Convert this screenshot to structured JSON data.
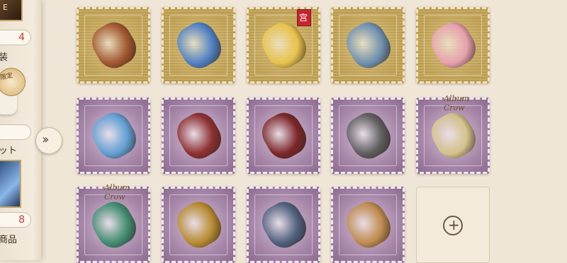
{
  "sidebar": {
    "corner_label": "E",
    "count_top": "4",
    "text_1": "装",
    "limited_badge": "限定",
    "text_2": "ット",
    "count_bottom": "8",
    "text_3": "商品",
    "expand_icon": "double-chevron-right-icon"
  },
  "slots": [
    {
      "kind": "gold",
      "item": "parchment-scroll-icon",
      "color": "#a0522d"
    },
    {
      "kind": "gold",
      "item": "feather-mask-icon",
      "color": "#4a7ec8"
    },
    {
      "kind": "gold",
      "item": "crystal-cluster-icon",
      "color": "#e9c34a",
      "seal": "宫"
    },
    {
      "kind": "gold",
      "item": "steampunk-gear-icon",
      "color": "#6b8fb3"
    },
    {
      "kind": "gold",
      "item": "cherry-blossom-icon",
      "color": "#e8a0b0"
    },
    {
      "kind": "purple",
      "item": "whale-icon",
      "color": "#5d9fd6"
    },
    {
      "kind": "purple",
      "item": "mace-icon",
      "color": "#8b2a2a"
    },
    {
      "kind": "purple",
      "item": "dagger-icon",
      "color": "#7a2020"
    },
    {
      "kind": "purple",
      "item": "skull-orb-icon",
      "color": "#5a5a5a"
    },
    {
      "kind": "purple",
      "item": "scroll-brush-icon",
      "color": "#d6c48a",
      "signature": "Album Crow"
    },
    {
      "kind": "purple",
      "item": "book-quill-icon",
      "color": "#3c8c6e",
      "signature": "Album Crow"
    },
    {
      "kind": "purple",
      "item": "fountain-pen-icon",
      "color": "#b88a2a"
    },
    {
      "kind": "purple",
      "item": "treasure-chest-icon",
      "color": "#4a5d7a"
    },
    {
      "kind": "purple",
      "item": "doll-cage-icon",
      "color": "#c08a4a"
    },
    {
      "kind": "empty",
      "item": "add-slot-icon",
      "color": "#6a5a48"
    }
  ]
}
